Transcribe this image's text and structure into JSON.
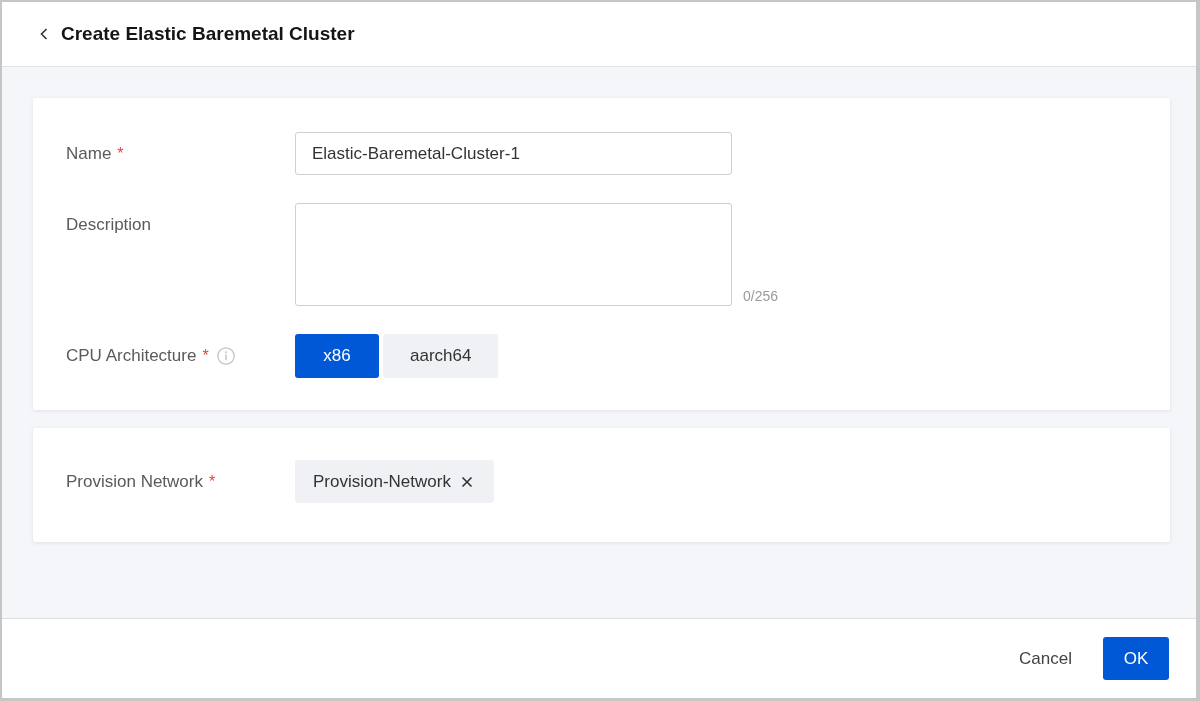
{
  "header": {
    "title": "Create Elastic Baremetal Cluster"
  },
  "sections": [
    {
      "fields": [
        {
          "kind": "text",
          "label": "Name",
          "required_mark": "*",
          "value": "Elastic-Baremetal-Cluster-1"
        },
        {
          "kind": "textarea",
          "label": "Description",
          "counter": "0/256"
        },
        {
          "kind": "segmented",
          "label": "CPU Architecture",
          "required_mark": "*",
          "info_icon": true,
          "options": [
            {
              "label": "x86",
              "selected": true
            },
            {
              "label": "aarch64",
              "selected": false
            }
          ]
        }
      ]
    },
    {
      "fields": [
        {
          "kind": "tags",
          "label": "Provision Network",
          "required_mark": "*",
          "tags": [
            "Provision-Network"
          ]
        }
      ]
    }
  ],
  "footer": {
    "buttons": [
      {
        "label": "Cancel",
        "kind": "secondary"
      },
      {
        "label": "OK",
        "kind": "primary"
      }
    ]
  }
}
